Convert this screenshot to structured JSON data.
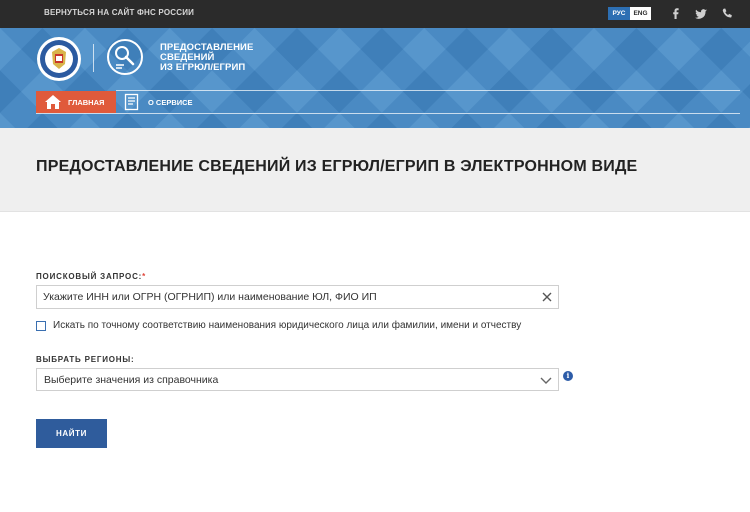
{
  "topbar": {
    "back_link": "ВЕРНУТЬСЯ НА САЙТ ФНС РОССИИ",
    "lang_ru": "РУС",
    "lang_en": "ENG",
    "social_icons": [
      "facebook-icon",
      "twitter-icon",
      "phone-icon"
    ]
  },
  "header": {
    "service_title_lines": [
      "ПРЕДОСТАВЛЕНИЕ",
      "СВЕДЕНИЙ",
      "ИЗ ЕГРЮЛ/ЕГРИП"
    ],
    "nav": {
      "home": "ГЛАВНАЯ",
      "about": "О СЕРВИСЕ"
    },
    "colors": {
      "header_bg": "#4a8ac3",
      "home_bg": "#e05a3b"
    }
  },
  "page": {
    "title": "ПРЕДОСТАВЛЕНИЕ СВЕДЕНИЙ ИЗ ЕГРЮЛ/ЕГРИП В ЭЛЕКТРОННОМ ВИДЕ"
  },
  "form": {
    "search_label": "ПОИСКОВЫЙ ЗАПРОС:",
    "required_mark": "*",
    "search_placeholder": "Укажите ИНН или ОГРН (ОГРНИП) или наименование ЮЛ, ФИО ИП",
    "search_value": "",
    "exact_match_label": "Искать по точному соответствию наименования юридического лица или фамилии, имени и отчеству",
    "exact_match_checked": false,
    "region_label": "ВЫБРАТЬ РЕГИОНЫ:",
    "region_placeholder": "Выберите значения из справочника",
    "info_symbol": "i",
    "find_button": "НАЙТИ",
    "colors": {
      "button_bg": "#2f5c9c",
      "required": "#e0463b"
    }
  }
}
